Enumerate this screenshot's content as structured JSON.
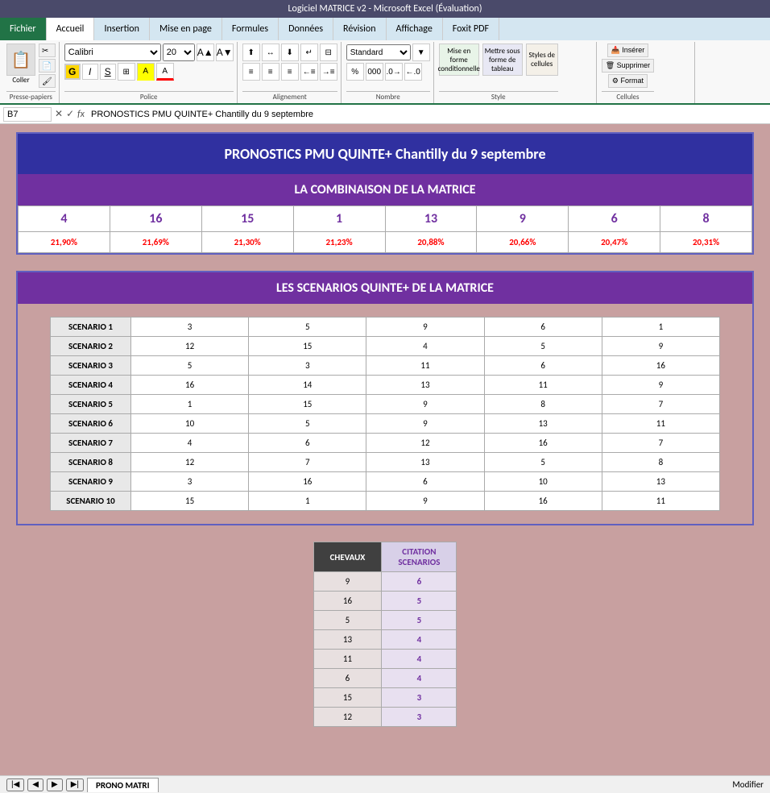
{
  "titleBar": {
    "text": "Logiciel MATRICE v2  -  Microsoft Excel (Évaluation)"
  },
  "ribbon": {
    "tabs": [
      "Fichier",
      "Accueil",
      "Insertion",
      "Mise en page",
      "Formules",
      "Données",
      "Révision",
      "Affichage",
      "Foxit PDF"
    ],
    "activeTab": "Accueil",
    "font": "Calibri",
    "fontSize": "20",
    "groups": {
      "pressePapiers": "Presse-papiers",
      "police": "Police",
      "alignement": "Alignement",
      "nombre": "Nombre",
      "style": "Style",
      "cellules": "Cellules"
    },
    "buttons": {
      "coller": "Coller",
      "inserer": "Insérer",
      "supprimer": "Supprimer",
      "format": "Format",
      "mise_en_forme": "Mise en forme conditionnelle",
      "mettre_sous_forme": "Mettre sous forme de tableau",
      "styles_cellules": "Styles de cellules",
      "standard": "Standard"
    }
  },
  "formulaBar": {
    "cellRef": "B7",
    "formula": "PRONOSTICS PMU QUINTE+ Chantilly du 9 septembre"
  },
  "mainTitle": "PRONOSTICS PMU QUINTE+ Chantilly du 9 septembre",
  "subTitle": "LA COMBINAISON DE LA MATRICE",
  "combination": {
    "numbers": [
      "4",
      "16",
      "15",
      "1",
      "13",
      "9",
      "6",
      "8"
    ],
    "percentages": [
      "21,90%",
      "21,69%",
      "21,30%",
      "21,23%",
      "20,88%",
      "20,66%",
      "20,47%",
      "20,31%"
    ]
  },
  "scenariosTitle": "LES SCENARIOS QUINTE+ DE LA MATRICE",
  "scenarios": [
    {
      "label": "SCENARIO 1",
      "cols": [
        "3",
        "5",
        "9",
        "6",
        "1"
      ]
    },
    {
      "label": "SCENARIO 2",
      "cols": [
        "12",
        "15",
        "4",
        "5",
        "9"
      ]
    },
    {
      "label": "SCENARIO 3",
      "cols": [
        "5",
        "3",
        "11",
        "6",
        "16"
      ]
    },
    {
      "label": "SCENARIO 4",
      "cols": [
        "16",
        "14",
        "13",
        "11",
        "9"
      ]
    },
    {
      "label": "SCENARIO 5",
      "cols": [
        "1",
        "15",
        "9",
        "8",
        "7"
      ]
    },
    {
      "label": "SCENARIO 6",
      "cols": [
        "10",
        "5",
        "9",
        "13",
        "11"
      ]
    },
    {
      "label": "SCENARIO 7",
      "cols": [
        "4",
        "6",
        "12",
        "16",
        "7"
      ]
    },
    {
      "label": "SCENARIO 8",
      "cols": [
        "12",
        "7",
        "13",
        "5",
        "8"
      ]
    },
    {
      "label": "SCENARIO 9",
      "cols": [
        "3",
        "16",
        "6",
        "10",
        "13"
      ]
    },
    {
      "label": "SCENARIO 10",
      "cols": [
        "15",
        "1",
        "9",
        "16",
        "11"
      ]
    }
  ],
  "chevauxTable": {
    "headers": [
      "CHEVAUX",
      "CITATION SCENARIOS"
    ],
    "rows": [
      {
        "cheval": "9",
        "citation": "6"
      },
      {
        "cheval": "16",
        "citation": "5"
      },
      {
        "cheval": "5",
        "citation": "5"
      },
      {
        "cheval": "13",
        "citation": "4"
      },
      {
        "cheval": "11",
        "citation": "4"
      },
      {
        "cheval": "6",
        "citation": "4"
      },
      {
        "cheval": "15",
        "citation": "3"
      },
      {
        "cheval": "12",
        "citation": "3"
      }
    ]
  },
  "sheetTabs": [
    "PRONO MATRI"
  ],
  "statusBar": {
    "mode": "Modifier"
  }
}
